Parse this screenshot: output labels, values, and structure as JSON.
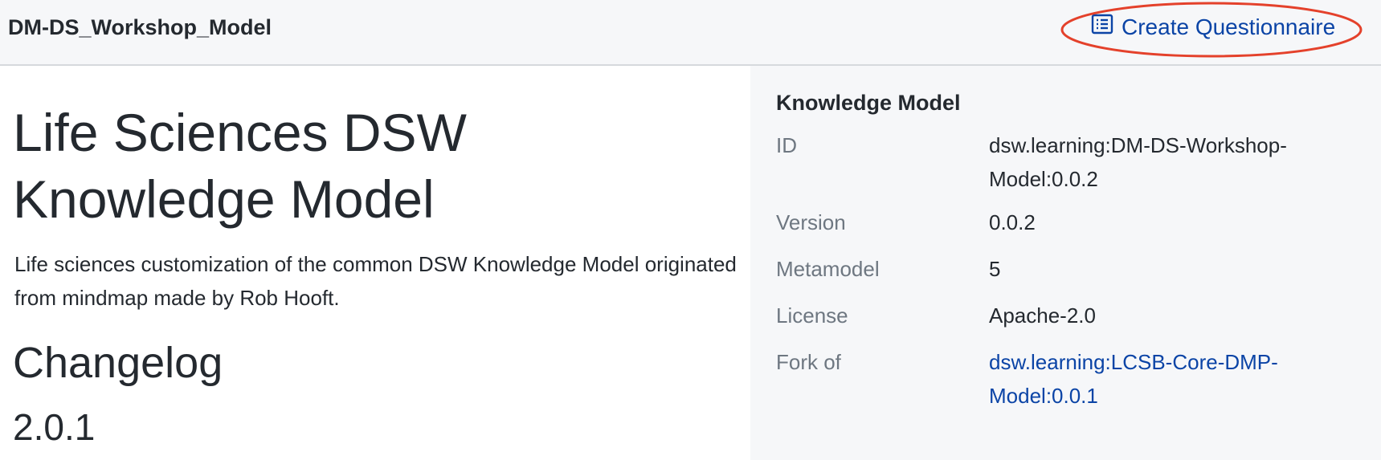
{
  "header": {
    "model_name": "DM-DS_Workshop_Model",
    "create_button_label": "Create Questionnaire",
    "create_button_icon": "list-icon",
    "highlight_color": "#e4412b"
  },
  "main": {
    "title": "Life Sciences DSW Knowledge Model",
    "description": "Life sciences customization of the common DSW Knowledge Model originated from mindmap made by Rob Hooft.",
    "changelog_heading": "Changelog",
    "version_heading": "2.0.1"
  },
  "sidebar": {
    "title": "Knowledge Model",
    "rows": [
      {
        "label": "ID",
        "value": "dsw.learning:DM-DS-Workshop-Model:0.0.2"
      },
      {
        "label": "Version",
        "value": "0.0.2"
      },
      {
        "label": "Metamodel",
        "value": "5"
      },
      {
        "label": "License",
        "value": "Apache-2.0"
      },
      {
        "label": "Fork of",
        "value": "dsw.learning:LCSB-Core-DMP-Model:0.0.1"
      }
    ]
  },
  "colors": {
    "link": "#0b44a6",
    "sidebar_bg": "#f6f7f9",
    "label": "#6e7781"
  }
}
